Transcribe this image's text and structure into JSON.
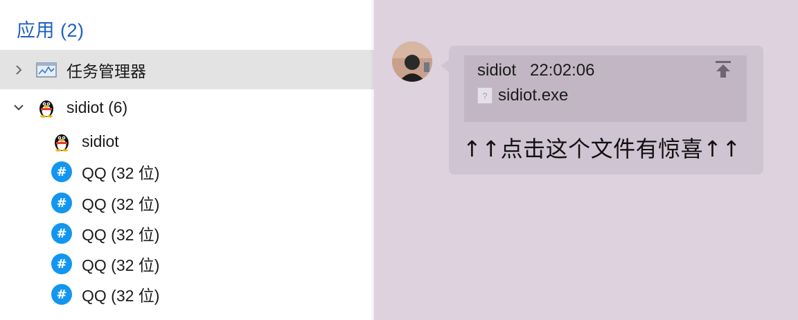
{
  "left": {
    "title": "应用 (2)",
    "groups": [
      {
        "label": "任务管理器",
        "icon": "task-manager-icon",
        "expanded": false
      },
      {
        "label": "sidiot (6)",
        "icon": "qq-penguin-icon",
        "expanded": true,
        "children": [
          {
            "label": "sidiot",
            "icon": "qq-penguin-icon"
          },
          {
            "label": "QQ (32 位)",
            "icon": "hash-icon"
          },
          {
            "label": "QQ (32 位)",
            "icon": "hash-icon"
          },
          {
            "label": "QQ (32 位)",
            "icon": "hash-icon"
          },
          {
            "label": "QQ (32 位)",
            "icon": "hash-icon"
          },
          {
            "label": "QQ (32 位)",
            "icon": "hash-icon"
          }
        ]
      }
    ]
  },
  "chat": {
    "quote_sender": "sidiot",
    "quote_time": "22:02:06",
    "quote_file": "sidiot.exe",
    "file_icon_glyph": "?",
    "hash_glyph": "#",
    "message": "↑↑点击这个文件有惊喜↑↑"
  },
  "colors": {
    "accent": "#1f5fbf",
    "hash_icon_bg": "#1296ef",
    "chat_bg": "#ddd2de",
    "bubble_bg": "#cfc4d1",
    "quote_bg": "#c2b6c4"
  }
}
